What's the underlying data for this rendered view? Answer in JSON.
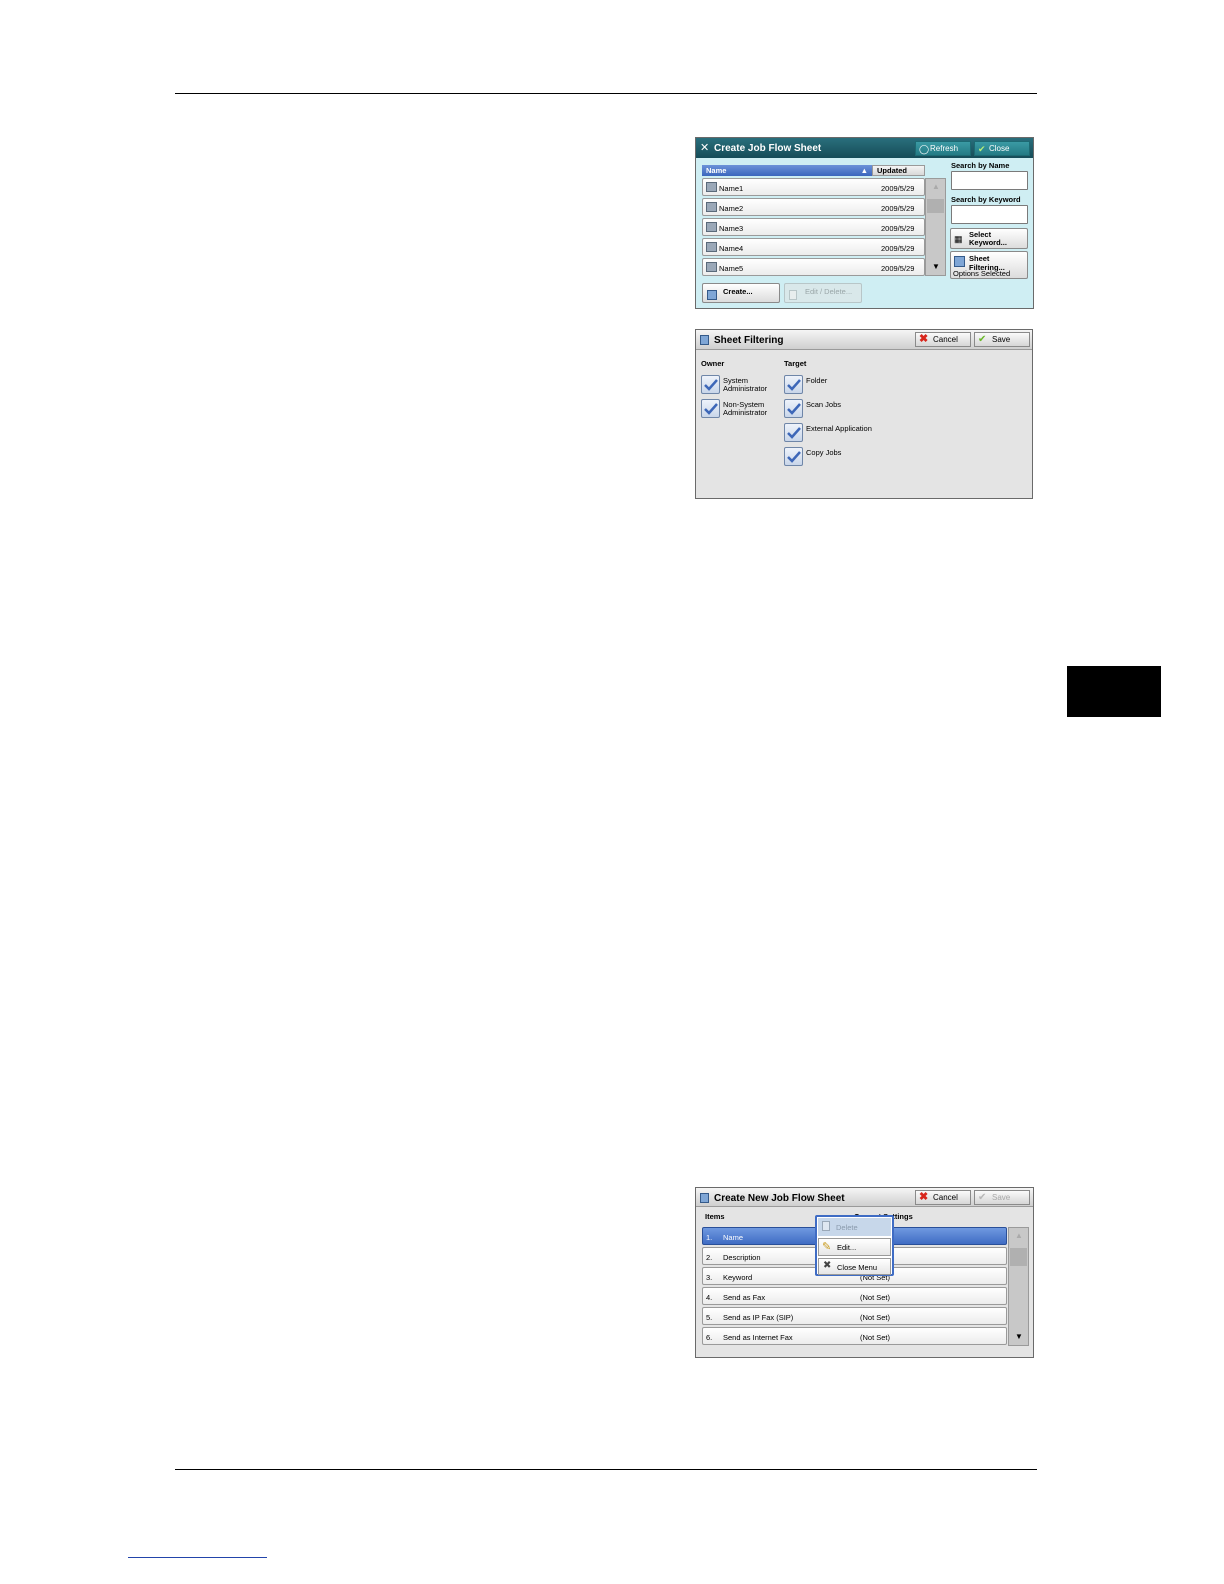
{
  "panel1": {
    "title": "Create Job Flow Sheet",
    "refresh_label": "Refresh",
    "close_label": "Close",
    "col_name": "Name",
    "col_updated": "Updated",
    "rows": [
      {
        "name": "Name1",
        "date": "2009/5/29"
      },
      {
        "name": "Name2",
        "date": "2009/5/29"
      },
      {
        "name": "Name3",
        "date": "2009/5/29"
      },
      {
        "name": "Name4",
        "date": "2009/5/29"
      },
      {
        "name": "Name5",
        "date": "2009/5/29"
      }
    ],
    "search_name_label": "Search by Name",
    "search_keyword_label": "Search by Keyword",
    "select_keyword_label": "Select Keyword...",
    "sheet_filtering_label": "Sheet Filtering...",
    "options_selected": "Options Selected",
    "create_label": "Create...",
    "edit_delete_label": "Edit / Delete..."
  },
  "panel2": {
    "title": "Sheet Filtering",
    "cancel_label": "Cancel",
    "save_label": "Save",
    "owner_label": "Owner",
    "target_label": "Target",
    "owner_items": [
      "System Administrator",
      "Non-System Administrator"
    ],
    "target_items": [
      "Folder",
      "Scan Jobs",
      "External Application",
      "Copy Jobs"
    ]
  },
  "panel3": {
    "title": "Create New Job Flow Sheet",
    "cancel_label": "Cancel",
    "save_label": "Save",
    "col_items": "Items",
    "col_settings": "Current Settings",
    "rows": [
      {
        "num": "1.",
        "item": "Name",
        "value": ""
      },
      {
        "num": "2.",
        "item": "Description",
        "value": ""
      },
      {
        "num": "3.",
        "item": "Keyword",
        "value": "(Not Set)"
      },
      {
        "num": "4.",
        "item": "Send as Fax",
        "value": "(Not Set)"
      },
      {
        "num": "5.",
        "item": "Send as IP Fax (SIP)",
        "value": "(Not Set)"
      },
      {
        "num": "6.",
        "item": "Send as Internet Fax",
        "value": "(Not Set)"
      }
    ],
    "menu": {
      "delete": "Delete",
      "edit": "Edit...",
      "close": "Close Menu"
    }
  }
}
